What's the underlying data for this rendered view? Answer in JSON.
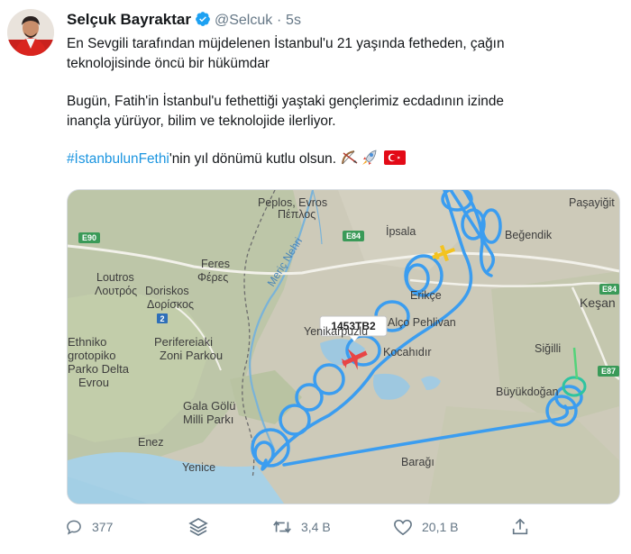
{
  "tweet": {
    "author": {
      "name": "Selçuk Bayraktar",
      "handle": "@Selcuk",
      "verified": true,
      "separator": "·",
      "time": "5s"
    },
    "body": {
      "line1": "En Sevgili tarafından müjdelenen İstanbul'u 21 yaşında fetheden, çağın",
      "line2": "teknolojisinde öncü bir hükümdar",
      "line3": "Bugün, Fatih'in İstanbul'u fethettiği yaştaki gençlerimiz ecdadının izinde",
      "line4": "inançla yürüyor, bilim ve teknolojide ilerliyor.",
      "hashtag": "#İstanbulunFethi",
      "line5_rest": "'nin yıl dönümü kutlu olsun.",
      "emojis": [
        "bow-and-arrow",
        "rocket",
        "turkey-flag"
      ]
    },
    "map": {
      "flight_label": "1453TB2",
      "places": {
        "peplos": "Peplos, Evros",
        "peplos_greek": "Πέπλος",
        "ipsala": "İpsala",
        "pasayigit": "Paşayiğit",
        "begendik": "Beğendik",
        "feres": "Feres",
        "feres_greek": "Φέρες",
        "loutros": "Loutros",
        "loutros_greek": "Λουτρός",
        "doriskos": "Doriskos",
        "doriskos_greek": "Δορίσκος",
        "meric": "Meriç Nehri",
        "enez_cayi": "Enez",
        "kesan": "Keşan",
        "yenikarpuzlu": "Yenikarpuzlu",
        "alco": "Alço Pehlivan",
        "kocahidir": "Kocahıdır",
        "sigilli": "Siğilli",
        "buyukdogan": "Büyükdoğan",
        "ethniko": "Ethniko",
        "grotopiko": "grotopiko",
        "parko_delta": "Parko Delta",
        "evrou": "Evrou",
        "periferei": "Perifereiaki",
        "zoni": "Zoni Parkou",
        "gala": "Gala Gölü",
        "milli": "Milli Parkı",
        "enez": "Enez",
        "yenice": "Yenice",
        "baragi": "Barağı",
        "ercec": "Erikçe"
      },
      "road_labels": {
        "e90": "E90",
        "e84a": "E84",
        "e84b": "E84",
        "e87": "E87",
        "two": "2"
      }
    },
    "actions": {
      "reply": "377",
      "retweet": "3,4 B",
      "like": "20,1 B"
    }
  },
  "colors": {
    "text": "#14171a",
    "muted": "#657786",
    "link": "#1b95e0",
    "verified": "#1da1f2",
    "flight_track": "#3b9df0",
    "plane_selected": "#e84545",
    "plane_other": "#f3c321"
  }
}
